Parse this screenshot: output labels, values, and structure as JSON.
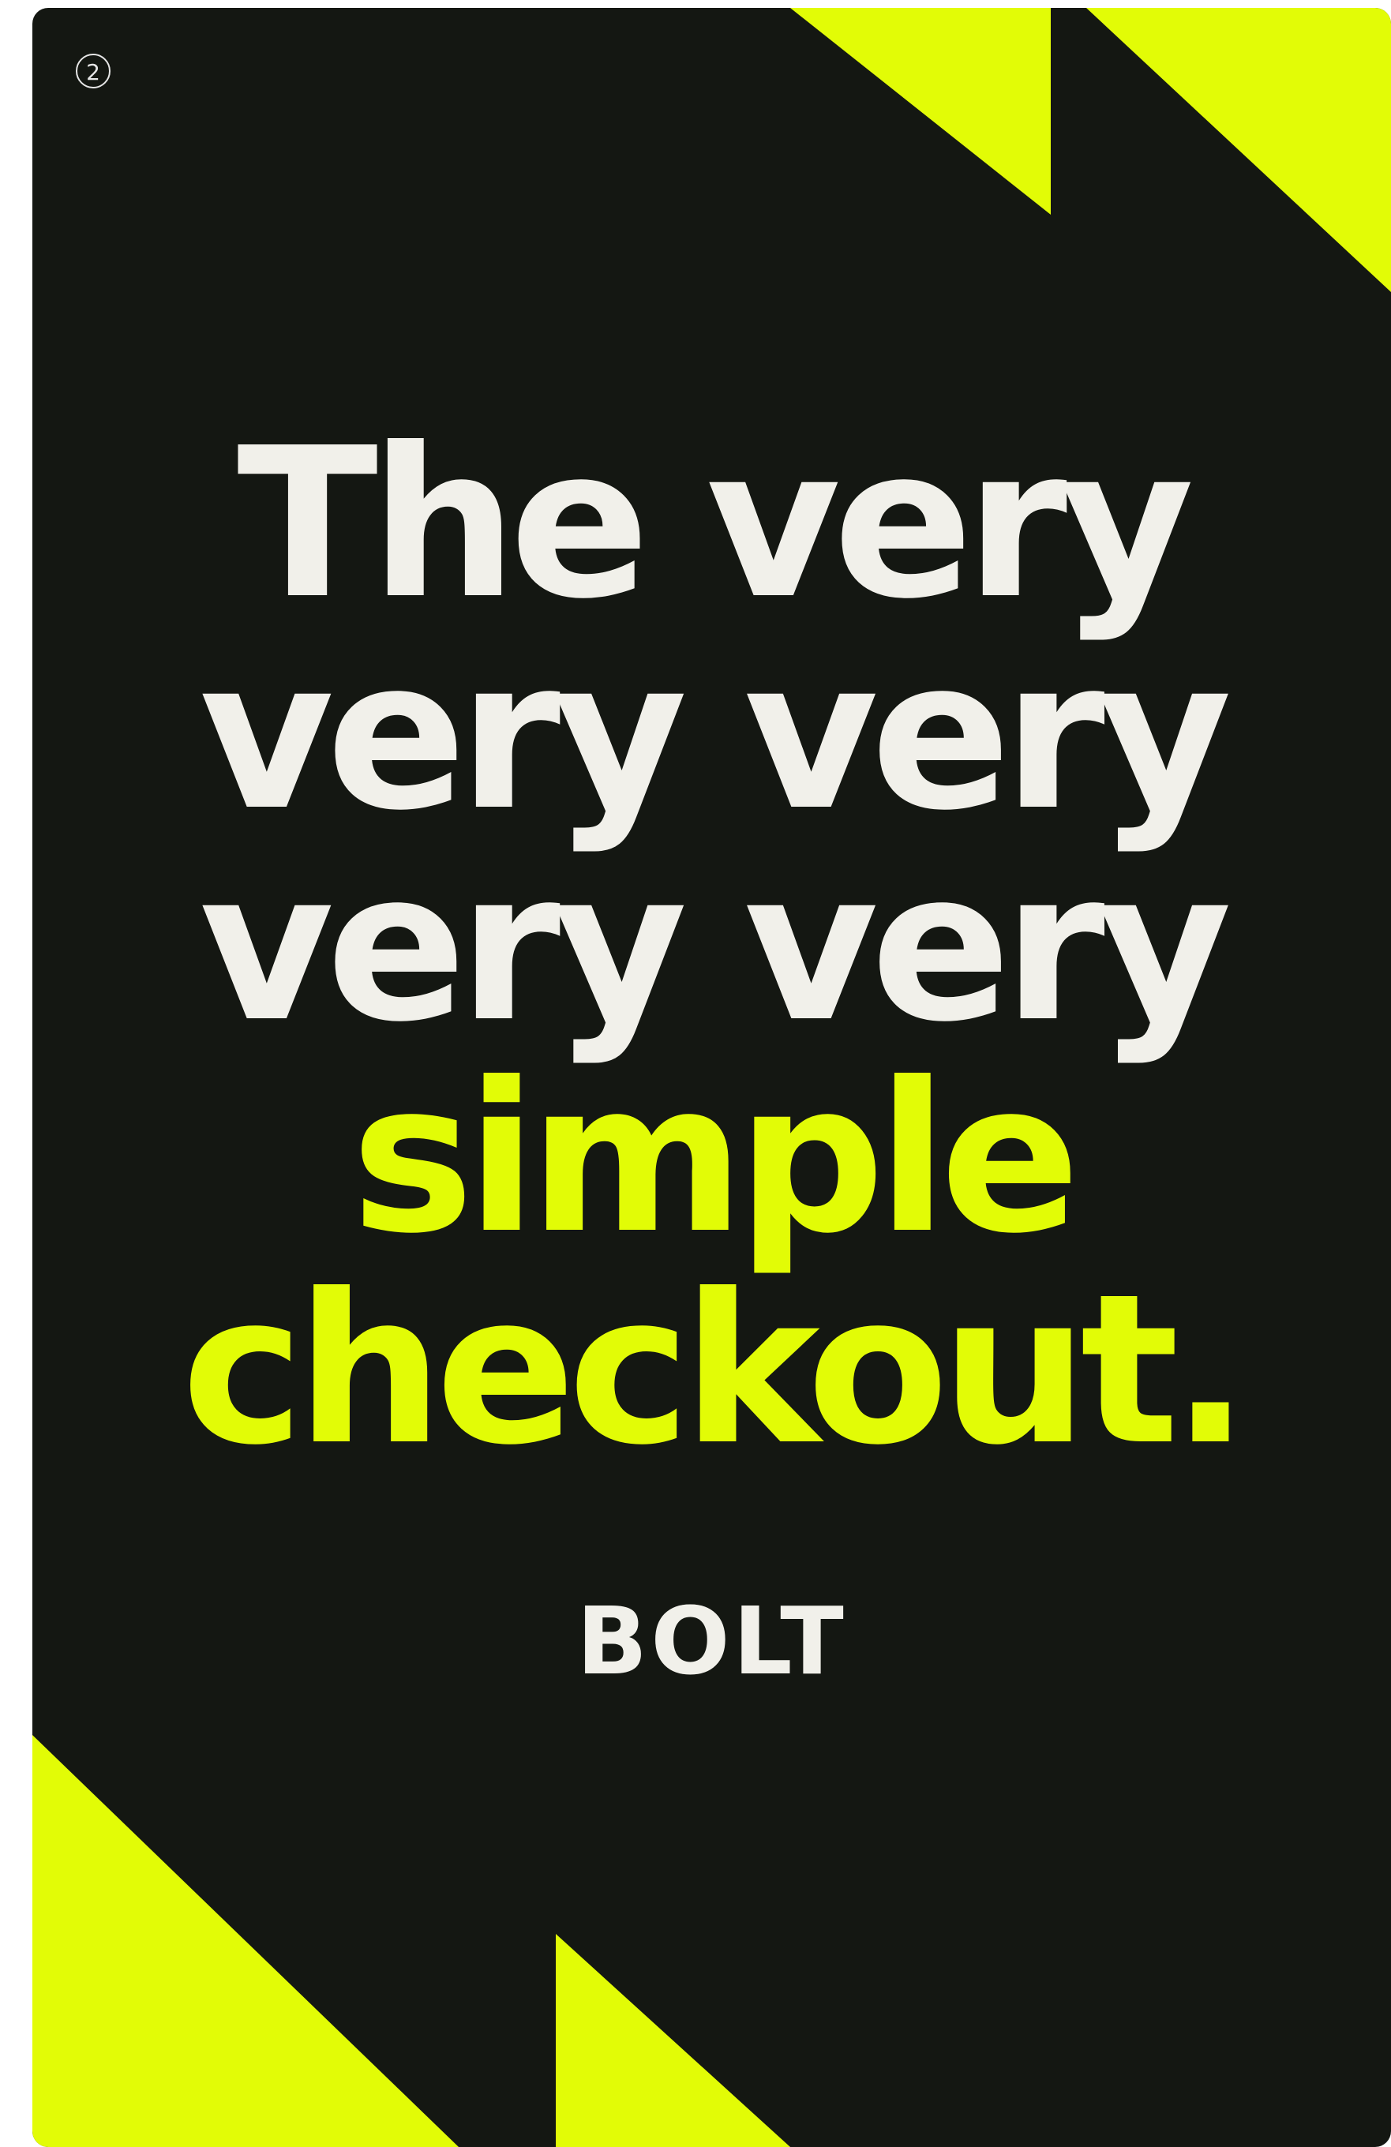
{
  "poster": {
    "page_number": "2",
    "headline": {
      "line1": "The very",
      "line2": "very very",
      "line3": "very very",
      "line4": "simple",
      "line5": "checkout."
    },
    "brand_logo_text": "BOLT"
  },
  "colors": {
    "background": "#141712",
    "accent": "#e2fc06",
    "text": "#f1f0ea"
  }
}
